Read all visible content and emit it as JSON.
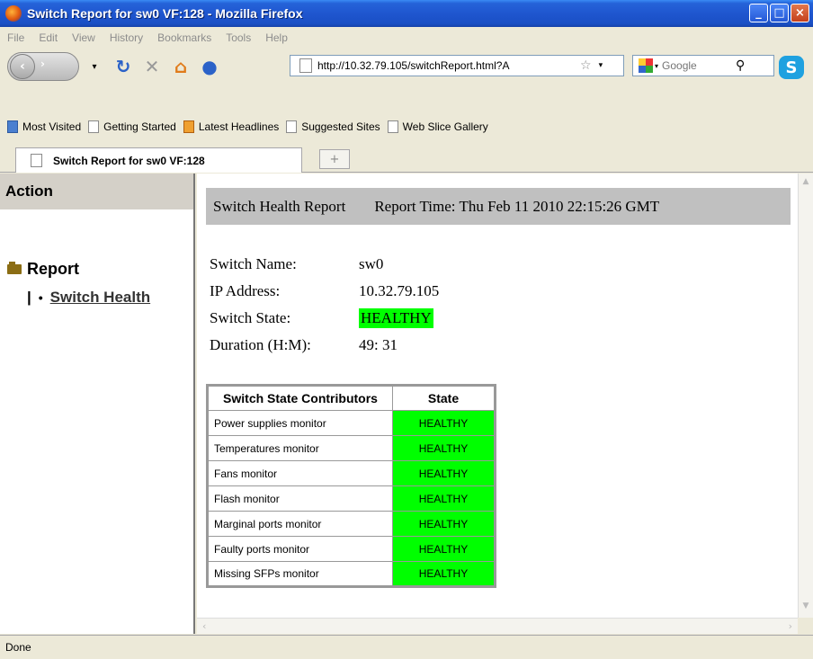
{
  "window": {
    "title": "Switch Report for sw0 VF:128 - Mozilla Firefox"
  },
  "menu": [
    "File",
    "Edit",
    "View",
    "History",
    "Bookmarks",
    "Tools",
    "Help"
  ],
  "nav": {
    "url": "http://10.32.79.105/switchReport.html?A",
    "search_placeholder": "Google"
  },
  "bookmarks": [
    "Most Visited",
    "Getting Started",
    "Latest Headlines",
    "Suggested Sites",
    "Web Slice Gallery"
  ],
  "tab": {
    "label": "Switch Report for sw0 VF:128",
    "new_tab": "+"
  },
  "sidebar": {
    "header": "Action",
    "report_label": "Report",
    "separator": "|",
    "bullet": "•",
    "link_label": "Switch Health"
  },
  "report": {
    "title": "Switch Health Report",
    "time": "Report Time: Thu Feb 11 2010 22:15:26 GMT",
    "fields": [
      {
        "label": "Switch Name:",
        "value": "sw0"
      },
      {
        "label": "IP Address:",
        "value": "10.32.79.105"
      },
      {
        "label": "Switch State:",
        "value": "HEALTHY"
      },
      {
        "label": "Duration (H:M):",
        "value": "49: 31"
      }
    ],
    "table": {
      "headers": [
        "Switch State Contributors",
        "State"
      ],
      "rows": [
        {
          "name": "Power supplies monitor",
          "state": "HEALTHY"
        },
        {
          "name": "Temperatures monitor",
          "state": "HEALTHY"
        },
        {
          "name": "Fans monitor",
          "state": "HEALTHY"
        },
        {
          "name": "Flash monitor",
          "state": "HEALTHY"
        },
        {
          "name": "Marginal ports monitor",
          "state": "HEALTHY"
        },
        {
          "name": "Faulty ports monitor",
          "state": "HEALTHY"
        },
        {
          "name": "Missing SFPs monitor",
          "state": "HEALTHY"
        }
      ]
    }
  },
  "status": "Done",
  "colors": {
    "healthy": "#00ff00",
    "titlebar": "#2563d9",
    "header_bar": "#c0c0c0"
  }
}
